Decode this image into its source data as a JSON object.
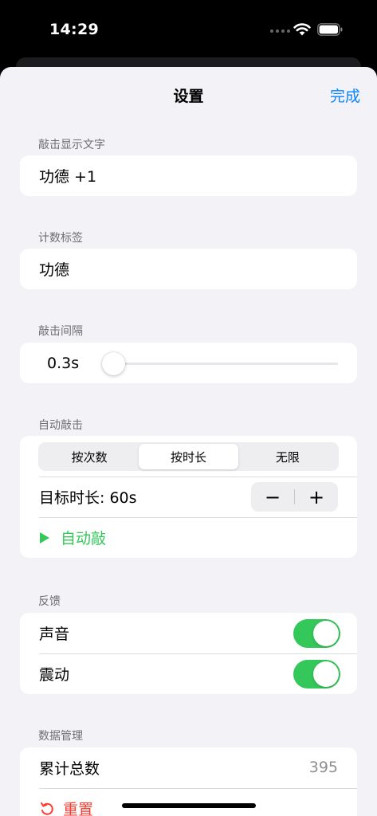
{
  "status_bar": {
    "time": "14:29"
  },
  "nav": {
    "title": "设置",
    "done_label": "完成"
  },
  "tap_text": {
    "header": "敲击显示文字",
    "value": "功德 +1"
  },
  "count_label": {
    "header": "计数标签",
    "value": "功德"
  },
  "interval": {
    "header": "敲击间隔",
    "value_label": "0.3s",
    "slider_fraction": 0.0
  },
  "auto_tap": {
    "header": "自动敲击",
    "modes": [
      "按次数",
      "按时长",
      "无限"
    ],
    "selected_mode": "按时长",
    "target_label": "目标时长: 60s",
    "minus": "−",
    "plus": "+",
    "start_icon": "play-icon",
    "start_label": "自动敲"
  },
  "feedback": {
    "header": "反馈",
    "sound_label": "声音",
    "sound_on": true,
    "vibration_label": "震动",
    "vibration_on": true
  },
  "data_management": {
    "header": "数据管理",
    "total_label": "累计总数",
    "total_value": "395",
    "reset_icon": "reset-icon",
    "reset_label": "重置"
  },
  "colors": {
    "accent": "#0a84ff",
    "green": "#34c759",
    "destructive": "#ff3b30"
  }
}
